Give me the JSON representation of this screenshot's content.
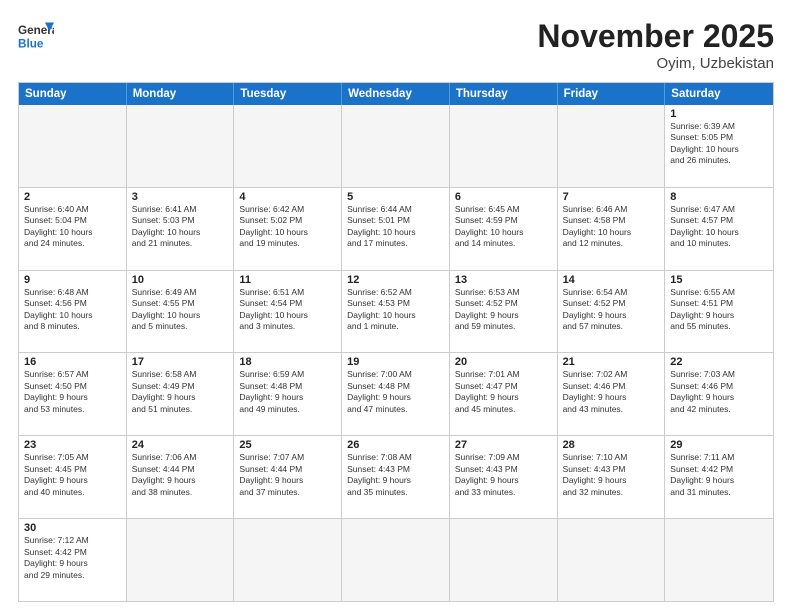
{
  "header": {
    "logo_general": "General",
    "logo_blue": "Blue",
    "month_title": "November 2025",
    "location": "Oyim, Uzbekistan"
  },
  "weekdays": [
    "Sunday",
    "Monday",
    "Tuesday",
    "Wednesday",
    "Thursday",
    "Friday",
    "Saturday"
  ],
  "weeks": [
    [
      {
        "day": "",
        "info": ""
      },
      {
        "day": "",
        "info": ""
      },
      {
        "day": "",
        "info": ""
      },
      {
        "day": "",
        "info": ""
      },
      {
        "day": "",
        "info": ""
      },
      {
        "day": "",
        "info": ""
      },
      {
        "day": "1",
        "info": "Sunrise: 6:39 AM\nSunset: 5:05 PM\nDaylight: 10 hours\nand 26 minutes."
      }
    ],
    [
      {
        "day": "2",
        "info": "Sunrise: 6:40 AM\nSunset: 5:04 PM\nDaylight: 10 hours\nand 24 minutes."
      },
      {
        "day": "3",
        "info": "Sunrise: 6:41 AM\nSunset: 5:03 PM\nDaylight: 10 hours\nand 21 minutes."
      },
      {
        "day": "4",
        "info": "Sunrise: 6:42 AM\nSunset: 5:02 PM\nDaylight: 10 hours\nand 19 minutes."
      },
      {
        "day": "5",
        "info": "Sunrise: 6:44 AM\nSunset: 5:01 PM\nDaylight: 10 hours\nand 17 minutes."
      },
      {
        "day": "6",
        "info": "Sunrise: 6:45 AM\nSunset: 4:59 PM\nDaylight: 10 hours\nand 14 minutes."
      },
      {
        "day": "7",
        "info": "Sunrise: 6:46 AM\nSunset: 4:58 PM\nDaylight: 10 hours\nand 12 minutes."
      },
      {
        "day": "8",
        "info": "Sunrise: 6:47 AM\nSunset: 4:57 PM\nDaylight: 10 hours\nand 10 minutes."
      }
    ],
    [
      {
        "day": "9",
        "info": "Sunrise: 6:48 AM\nSunset: 4:56 PM\nDaylight: 10 hours\nand 8 minutes."
      },
      {
        "day": "10",
        "info": "Sunrise: 6:49 AM\nSunset: 4:55 PM\nDaylight: 10 hours\nand 5 minutes."
      },
      {
        "day": "11",
        "info": "Sunrise: 6:51 AM\nSunset: 4:54 PM\nDaylight: 10 hours\nand 3 minutes."
      },
      {
        "day": "12",
        "info": "Sunrise: 6:52 AM\nSunset: 4:53 PM\nDaylight: 10 hours\nand 1 minute."
      },
      {
        "day": "13",
        "info": "Sunrise: 6:53 AM\nSunset: 4:52 PM\nDaylight: 9 hours\nand 59 minutes."
      },
      {
        "day": "14",
        "info": "Sunrise: 6:54 AM\nSunset: 4:52 PM\nDaylight: 9 hours\nand 57 minutes."
      },
      {
        "day": "15",
        "info": "Sunrise: 6:55 AM\nSunset: 4:51 PM\nDaylight: 9 hours\nand 55 minutes."
      }
    ],
    [
      {
        "day": "16",
        "info": "Sunrise: 6:57 AM\nSunset: 4:50 PM\nDaylight: 9 hours\nand 53 minutes."
      },
      {
        "day": "17",
        "info": "Sunrise: 6:58 AM\nSunset: 4:49 PM\nDaylight: 9 hours\nand 51 minutes."
      },
      {
        "day": "18",
        "info": "Sunrise: 6:59 AM\nSunset: 4:48 PM\nDaylight: 9 hours\nand 49 minutes."
      },
      {
        "day": "19",
        "info": "Sunrise: 7:00 AM\nSunset: 4:48 PM\nDaylight: 9 hours\nand 47 minutes."
      },
      {
        "day": "20",
        "info": "Sunrise: 7:01 AM\nSunset: 4:47 PM\nDaylight: 9 hours\nand 45 minutes."
      },
      {
        "day": "21",
        "info": "Sunrise: 7:02 AM\nSunset: 4:46 PM\nDaylight: 9 hours\nand 43 minutes."
      },
      {
        "day": "22",
        "info": "Sunrise: 7:03 AM\nSunset: 4:46 PM\nDaylight: 9 hours\nand 42 minutes."
      }
    ],
    [
      {
        "day": "23",
        "info": "Sunrise: 7:05 AM\nSunset: 4:45 PM\nDaylight: 9 hours\nand 40 minutes."
      },
      {
        "day": "24",
        "info": "Sunrise: 7:06 AM\nSunset: 4:44 PM\nDaylight: 9 hours\nand 38 minutes."
      },
      {
        "day": "25",
        "info": "Sunrise: 7:07 AM\nSunset: 4:44 PM\nDaylight: 9 hours\nand 37 minutes."
      },
      {
        "day": "26",
        "info": "Sunrise: 7:08 AM\nSunset: 4:43 PM\nDaylight: 9 hours\nand 35 minutes."
      },
      {
        "day": "27",
        "info": "Sunrise: 7:09 AM\nSunset: 4:43 PM\nDaylight: 9 hours\nand 33 minutes."
      },
      {
        "day": "28",
        "info": "Sunrise: 7:10 AM\nSunset: 4:43 PM\nDaylight: 9 hours\nand 32 minutes."
      },
      {
        "day": "29",
        "info": "Sunrise: 7:11 AM\nSunset: 4:42 PM\nDaylight: 9 hours\nand 31 minutes."
      }
    ],
    [
      {
        "day": "30",
        "info": "Sunrise: 7:12 AM\nSunset: 4:42 PM\nDaylight: 9 hours\nand 29 minutes."
      },
      {
        "day": "",
        "info": ""
      },
      {
        "day": "",
        "info": ""
      },
      {
        "day": "",
        "info": ""
      },
      {
        "day": "",
        "info": ""
      },
      {
        "day": "",
        "info": ""
      },
      {
        "day": "",
        "info": ""
      }
    ]
  ]
}
